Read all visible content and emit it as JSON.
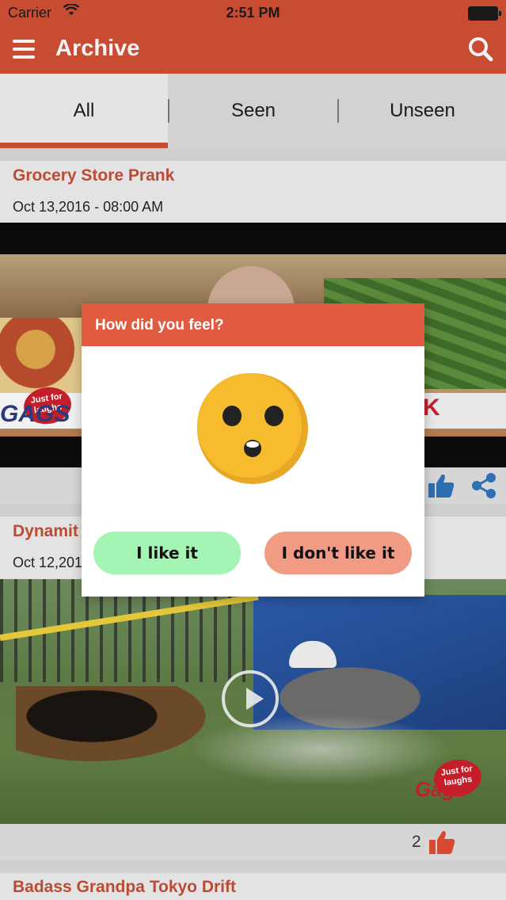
{
  "status_bar": {
    "carrier": "Carrier",
    "time": "2:51 PM"
  },
  "nav": {
    "title": "Archive",
    "menu_icon": "hamburger-menu-icon",
    "search_icon": "search-icon",
    "bar_color": "#c84c32"
  },
  "tabs": [
    {
      "label": "All",
      "active": true
    },
    {
      "label": "Seen",
      "active": false
    },
    {
      "label": "Unseen",
      "active": false
    }
  ],
  "feed": [
    {
      "title": "Grocery Store Prank",
      "date": "Oct 13,2016 - 08:00 AM"
    },
    {
      "title": "Dynamit",
      "date": "Oct 12,201",
      "likes": "2"
    },
    {
      "title": "Badass Grandpa Tokyo Drift"
    }
  ],
  "video_overlay": {
    "logo_text": "Just for laughs",
    "brand_text": "GAGS",
    "brand_text_alt": "Gags",
    "sign_fragment": "K"
  },
  "dialog": {
    "title": "How did you feel?",
    "emoji": "surprised-face-icon",
    "like_label": "I like it",
    "dislike_label": "I don't like it",
    "header_color": "#e15b41",
    "like_color": "#a4f4b4",
    "dislike_color": "#f19a84"
  }
}
